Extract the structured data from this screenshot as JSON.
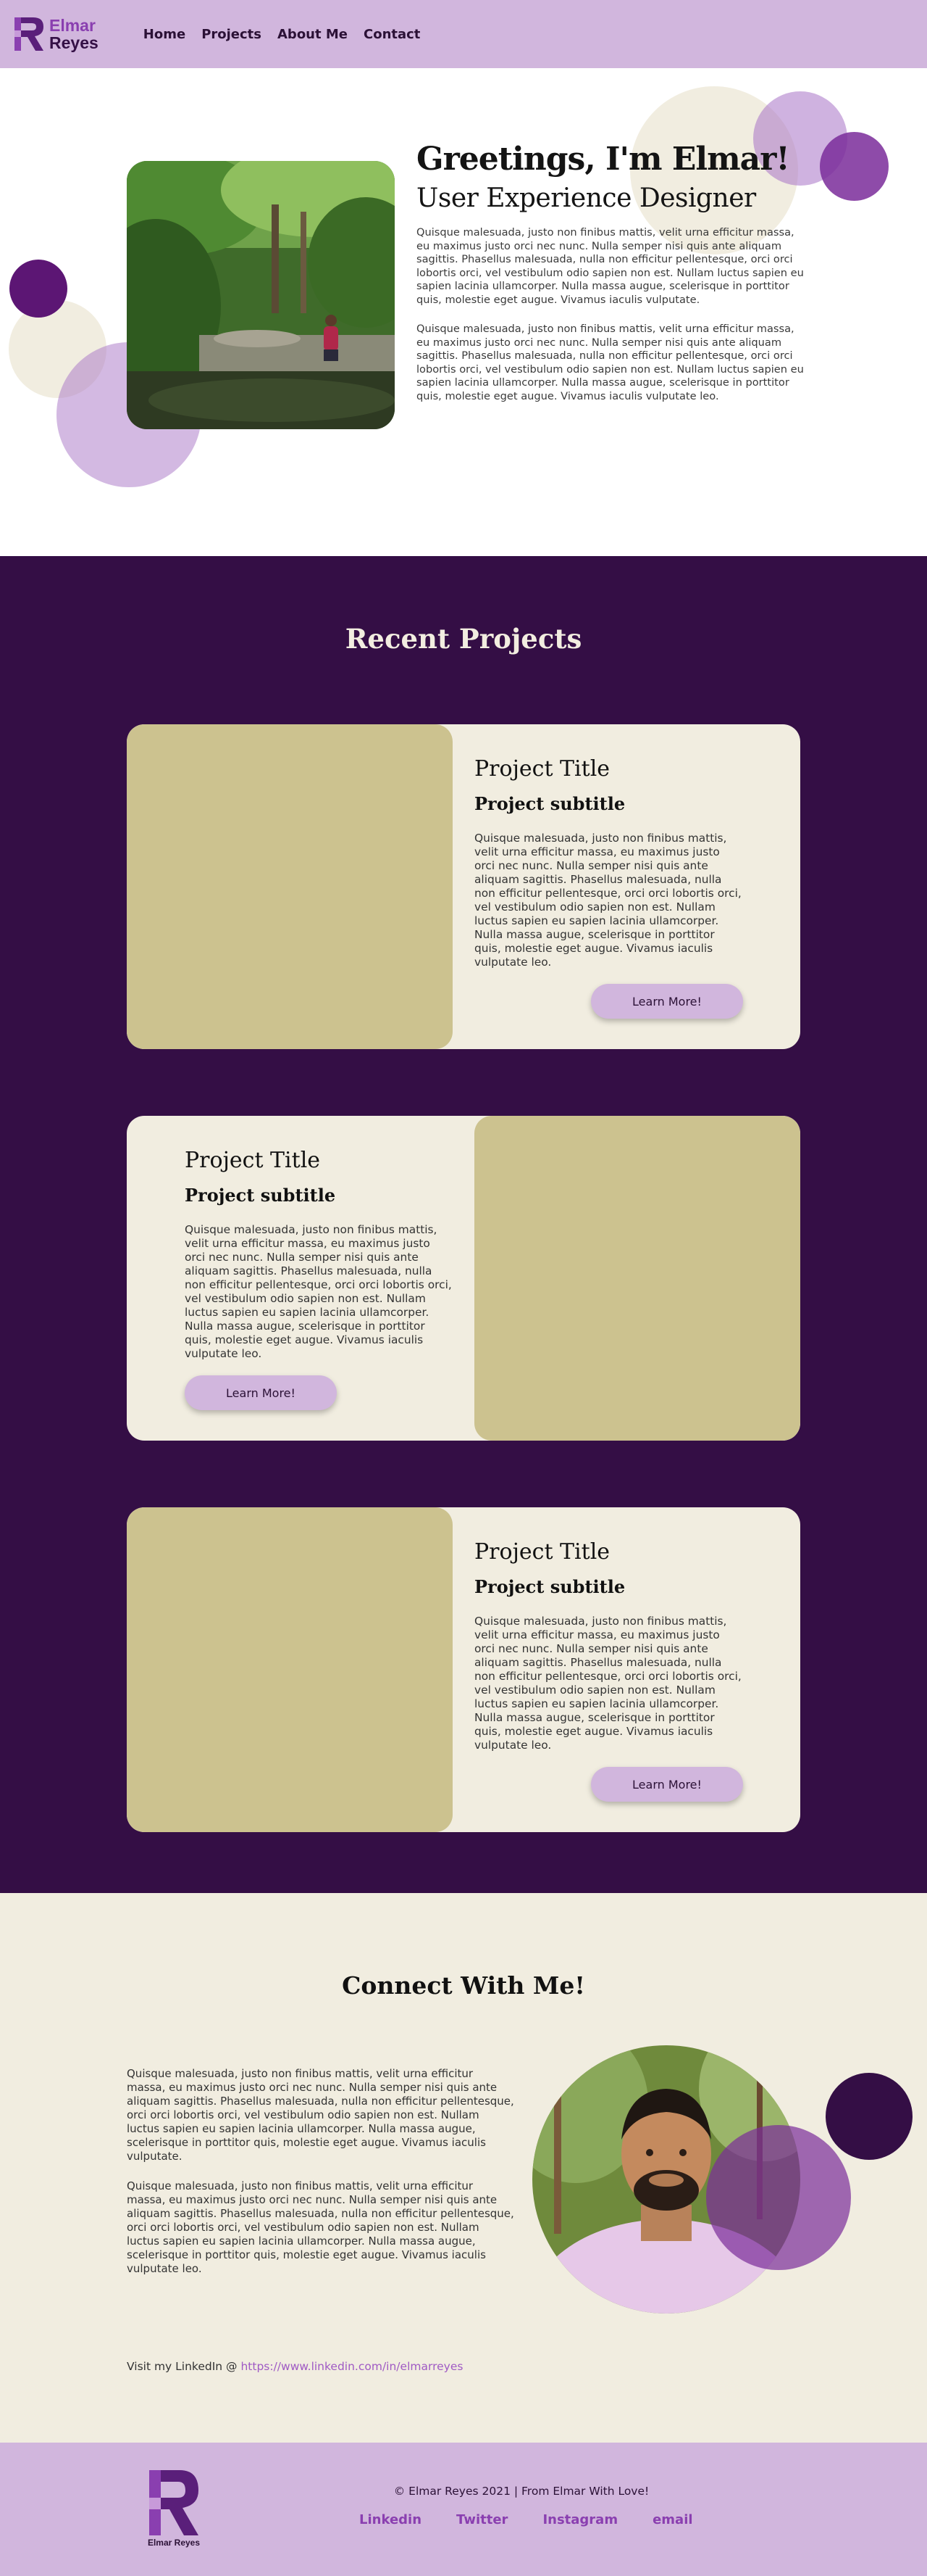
{
  "brand": {
    "name_line1": "Elmar",
    "name_line2": "Reyes",
    "colors": {
      "lavender": "#d1b6dd",
      "deep_purple": "#340e45",
      "purple": "#8a3fb0",
      "cream": "#f1ede0",
      "khaki": "#ccc28f"
    }
  },
  "nav": {
    "items": [
      {
        "label": "Home"
      },
      {
        "label": "Projects"
      },
      {
        "label": "About Me"
      },
      {
        "label": "Contact"
      }
    ]
  },
  "hero": {
    "greeting": "Greetings, I'm Elmar!",
    "role": "User Experience Designer",
    "paragraphs": [
      "Quisque malesuada, justo non finibus mattis, velit urna efficitur massa, eu maximus justo orci nec nunc. Nulla semper nisi quis ante aliquam sagittis. Phasellus malesuada, nulla non efficitur pellentesque, orci orci lobortis orci, vel vestibulum odio sapien non est. Nullam luctus sapien eu sapien lacinia ullamcorper. Nulla massa augue, scelerisque in porttitor quis, molestie eget augue. Vivamus iaculis vulputate.",
      "Quisque malesuada, justo non finibus mattis, velit urna efficitur massa, eu maximus justo orci nec nunc. Nulla semper nisi quis ante aliquam sagittis. Phasellus malesuada, nulla non efficitur pellentesque, orci orci lobortis orci, vel vestibulum odio sapien non est. Nullam luctus sapien eu sapien lacinia ullamcorper. Nulla massa augue, scelerisque in porttitor quis, molestie eget augue. Vivamus iaculis vulputate leo."
    ]
  },
  "projects": {
    "heading": "Recent Projects",
    "items": [
      {
        "title": "Project Title",
        "subtitle": "Project subtitle",
        "description": "Quisque malesuada, justo non finibus mattis, velit urna efficitur massa, eu maximus justo orci nec nunc. Nulla semper nisi quis ante aliquam sagittis. Phasellus malesuada, nulla non efficitur pellentesque, orci orci lobortis orci, vel vestibulum odio sapien non est. Nullam luctus sapien eu sapien lacinia ullamcorper. Nulla massa augue, scelerisque in porttitor quis, molestie eget augue. Vivamus iaculis vulputate leo.",
        "button": "Learn More!"
      },
      {
        "title": "Project Title",
        "subtitle": "Project subtitle",
        "description": "Quisque malesuada, justo non finibus mattis, velit urna efficitur massa, eu maximus justo orci nec nunc. Nulla semper nisi quis ante aliquam sagittis. Phasellus malesuada, nulla non efficitur pellentesque, orci orci lobortis orci, vel vestibulum odio sapien non est. Nullam luctus sapien eu sapien lacinia ullamcorper. Nulla massa augue, scelerisque in porttitor quis, molestie eget augue. Vivamus iaculis vulputate leo.",
        "button": "Learn More!"
      },
      {
        "title": "Project Title",
        "subtitle": "Project subtitle",
        "description": "Quisque malesuada, justo non finibus mattis, velit urna efficitur massa, eu maximus justo orci nec nunc. Nulla semper nisi quis ante aliquam sagittis. Phasellus malesuada, nulla non efficitur pellentesque, orci orci lobortis orci, vel vestibulum odio sapien non est. Nullam luctus sapien eu sapien lacinia ullamcorper. Nulla massa augue, scelerisque in porttitor quis, molestie eget augue. Vivamus iaculis vulputate leo.",
        "button": "Learn More!"
      }
    ]
  },
  "connect": {
    "heading": "Connect With Me!",
    "paragraphs": [
      "Quisque malesuada, justo non finibus mattis, velit urna efficitur massa, eu maximus justo orci nec nunc. Nulla semper nisi quis ante aliquam sagittis. Phasellus malesuada, nulla non efficitur pellentesque, orci orci lobortis orci, vel vestibulum odio sapien non est. Nullam luctus sapien eu sapien lacinia ullamcorper. Nulla massa augue, scelerisque in porttitor quis, molestie eget augue. Vivamus iaculis vulputate.",
      "Quisque malesuada, justo non finibus mattis, velit urna efficitur massa, eu maximus justo orci nec nunc. Nulla semper nisi quis ante aliquam sagittis. Phasellus malesuada, nulla non efficitur pellentesque, orci orci lobortis orci, vel vestibulum odio sapien non est. Nullam luctus sapien eu sapien lacinia ullamcorper. Nulla massa augue, scelerisque in porttitor quis, molestie eget augue. Vivamus iaculis vulputate leo."
    ],
    "linkedin_prefix": "Visit my LinkedIn @ ",
    "linkedin_url": "https://www.linkedin.com/in/elmarreyes"
  },
  "footer": {
    "logo_name": "Elmar Reyes",
    "copyright": "© Elmar Reyes 2021 | From Elmar With Love!",
    "links": [
      {
        "label": "Linkedin"
      },
      {
        "label": "Twitter"
      },
      {
        "label": "Instagram"
      },
      {
        "label": "email"
      }
    ]
  }
}
